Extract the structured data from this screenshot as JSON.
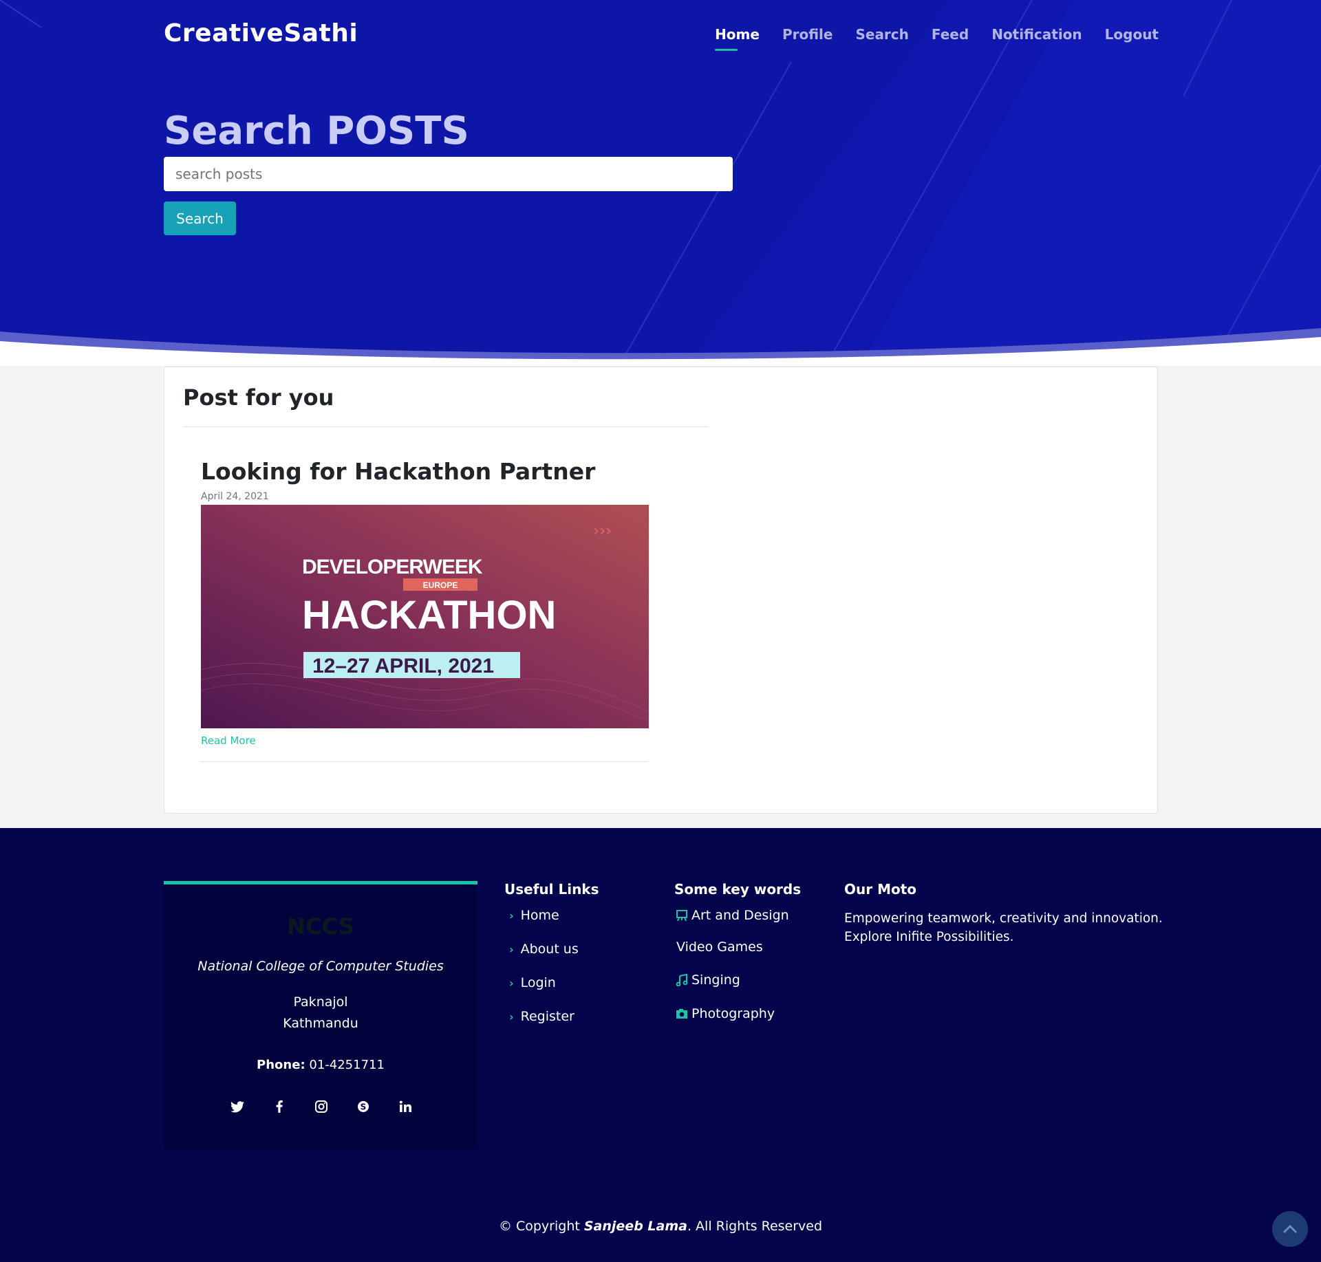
{
  "header": {
    "brand": "CreativeSathi",
    "nav": [
      {
        "label": "Home",
        "active": true
      },
      {
        "label": "Profile"
      },
      {
        "label": "Search"
      },
      {
        "label": "Feed"
      },
      {
        "label": "Notification"
      },
      {
        "label": "Logout"
      }
    ]
  },
  "hero": {
    "title": "Search POSTS",
    "search_placeholder": "search posts",
    "search_button": "Search"
  },
  "main": {
    "section_title": "Post for you",
    "post": {
      "title": "Looking for Hackathon Partner",
      "date": "April 24, 2021",
      "image": {
        "brand_main": "DEVELOPERWEEK",
        "brand_sub": "EUROPE",
        "headline": "HACKATHON",
        "dates": "12–27 APRIL, 2021"
      },
      "read_more": "Read More"
    }
  },
  "footer": {
    "info": {
      "name": "NCCS",
      "college": "National College of Computer Studies",
      "address_line1": "Paknajol",
      "address_line2": "Kathmandu",
      "phone_label": "Phone:",
      "phone": "01-4251711",
      "socials": [
        "twitter-icon",
        "facebook-icon",
        "instagram-icon",
        "skype-icon",
        "linkedin-icon"
      ]
    },
    "useful_links": {
      "title": "Useful Links",
      "items": [
        "Home",
        "About us",
        "Login",
        "Register"
      ]
    },
    "keywords": {
      "title": "Some key words",
      "items": [
        {
          "label": "Art and Design",
          "icon": "easel-icon"
        },
        {
          "label": "Video Games",
          "icon": ""
        },
        {
          "label": "Singing",
          "icon": "music-icon"
        },
        {
          "label": "Photography",
          "icon": "camera-icon"
        }
      ]
    },
    "moto": {
      "title": "Our Moto",
      "text": "Empowering teamwork, creativity and innovation. Explore Inifite Possibilities."
    },
    "copyright_prefix": "© Copyright",
    "copyright_name": "Sanjeeb Lama",
    "copyright_suffix": ". All Rights Reserved"
  },
  "colors": {
    "hero_bg": "#0e16a8",
    "accent": "#1bc5a3",
    "button": "#17a2b8",
    "footer_bg": "#04044c"
  }
}
